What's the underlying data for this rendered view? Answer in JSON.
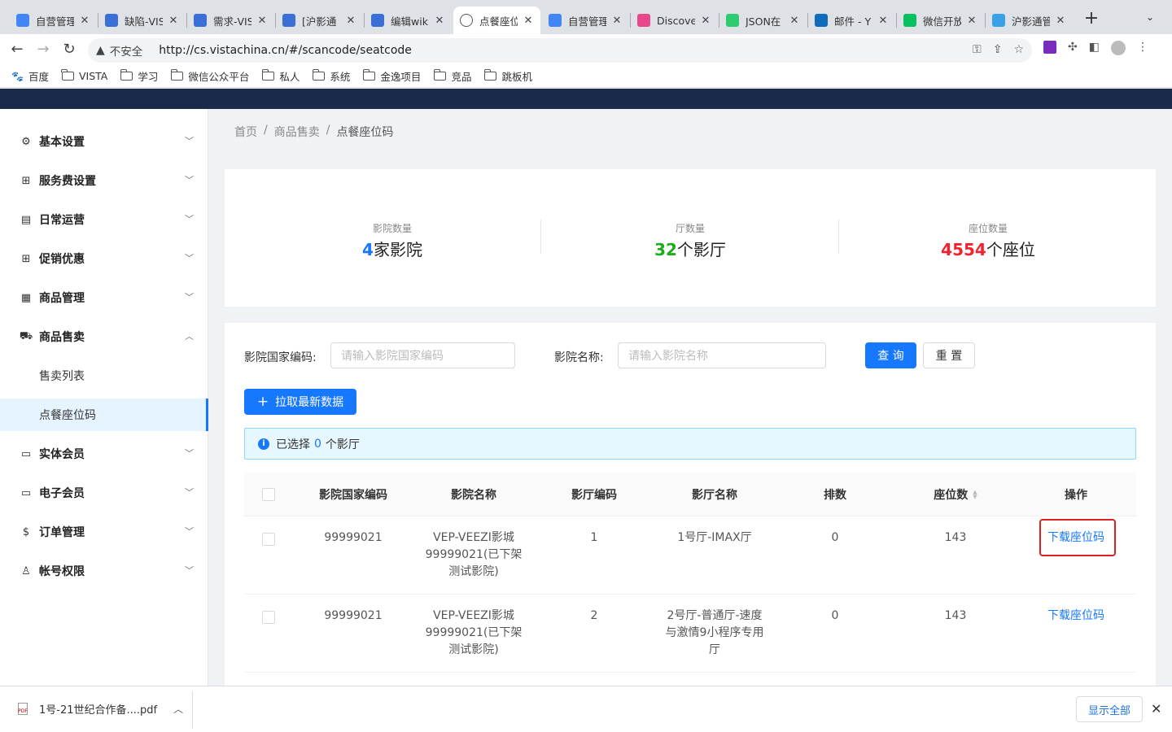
{
  "browser": {
    "tabs": [
      {
        "title": "自营管理",
        "favicon": "grid-colorful-icon",
        "color": "#4285f4"
      },
      {
        "title": "缺陷-VIS",
        "favicon": "vista-icon",
        "color": "#3a6fd8"
      },
      {
        "title": "需求-VIS",
        "favicon": "vista-icon",
        "color": "#3a6fd8"
      },
      {
        "title": "[沪影通",
        "favicon": "vista-icon",
        "color": "#3a6fd8"
      },
      {
        "title": "编辑wik",
        "favicon": "vista-icon",
        "color": "#3a6fd8"
      },
      {
        "title": "点餐座位",
        "favicon": "globe-icon",
        "color": "#555555",
        "active": true
      },
      {
        "title": "自营管理",
        "favicon": "grid-colorful-icon",
        "color": "#4285f4"
      },
      {
        "title": "Discove",
        "favicon": "kibana-icon",
        "color": "#e8478b"
      },
      {
        "title": "JSON在",
        "favicon": "json-icon",
        "color": "#2ecc71"
      },
      {
        "title": "邮件 - Y",
        "favicon": "outlook-icon",
        "color": "#0f6cbd"
      },
      {
        "title": "微信开放",
        "favicon": "wechat-icon",
        "color": "#07c160"
      },
      {
        "title": "沪影通管",
        "favicon": "hy-icon",
        "color": "#3aa0e8"
      }
    ],
    "security_label": "不安全",
    "url": "http://cs.vistachina.cn/#/scancode/seatcode",
    "bookmarks": [
      "百度",
      "VISTA",
      "学习",
      "微信公众平台",
      "私人",
      "系统",
      "金逸项目",
      "竞品",
      "跳板机"
    ]
  },
  "sidebar": {
    "menus": [
      {
        "label": "基本设置",
        "icon": "gear-icon",
        "glyph": "⚙",
        "expanded": false
      },
      {
        "label": "服务费设置",
        "icon": "gift-icon",
        "glyph": "⊞",
        "expanded": false
      },
      {
        "label": "日常运营",
        "icon": "calendar-icon",
        "glyph": "▤",
        "expanded": false
      },
      {
        "label": "促销优惠",
        "icon": "gift-icon",
        "glyph": "⊞",
        "expanded": false
      },
      {
        "label": "商品管理",
        "icon": "shop-icon",
        "glyph": "▦",
        "expanded": false
      },
      {
        "label": "商品售卖",
        "icon": "cart-icon",
        "glyph": "⛟",
        "expanded": true
      },
      {
        "label": "实体会员",
        "icon": "idcard-icon",
        "glyph": "▭",
        "expanded": false
      },
      {
        "label": "电子会员",
        "icon": "idcard-icon",
        "glyph": "▭",
        "expanded": false
      },
      {
        "label": "订单管理",
        "icon": "dollar-icon",
        "glyph": "$",
        "expanded": false
      },
      {
        "label": "帐号权限",
        "icon": "user-icon",
        "glyph": "♙",
        "expanded": false
      }
    ],
    "submenu": [
      {
        "label": "售卖列表",
        "active": false
      },
      {
        "label": "点餐座位码",
        "active": true
      }
    ]
  },
  "breadcrumb": [
    "首页",
    "商品售卖",
    "点餐座位码"
  ],
  "stats": [
    {
      "label": "影院数量",
      "value": "4",
      "unit": "家影院",
      "color": "#1677ff"
    },
    {
      "label": "厅数量",
      "value": "32",
      "unit": "个影厅",
      "color": "#1aad19"
    },
    {
      "label": "座位数量",
      "value": "4554",
      "unit": "个座位",
      "color": "#f5222d"
    }
  ],
  "filters": {
    "code_label": "影院国家编码:",
    "code_placeholder": "请输入影院国家编码",
    "name_label": "影院名称:",
    "name_placeholder": "请输入影院名称",
    "search_button": "查 询",
    "reset_button": "重 置"
  },
  "fetch_button": "拉取最新数据",
  "selection": {
    "prefix": "已选择",
    "count": "0",
    "suffix": "个影厅"
  },
  "table": {
    "columns": [
      "影院国家编码",
      "影院名称",
      "影厅编码",
      "影厅名称",
      "排数",
      "座位数",
      "操作"
    ],
    "rows": [
      {
        "code": "99999021",
        "cinema": "VEP-VEEZI影城99999021(已下架测试影院)",
        "hall_code": "1",
        "hall_name": "1号厅-IMAX厅",
        "rows": "0",
        "seats": "143",
        "action": "下载座位码"
      },
      {
        "code": "99999021",
        "cinema": "VEP-VEEZI影城99999021(已下架测试影院)",
        "hall_code": "2",
        "hall_name": "2号厅-普通厅-速度与激情9小程序专用厅",
        "rows": "0",
        "seats": "143",
        "action": "下载座位码"
      }
    ]
  },
  "downloads": {
    "file": "1号-21世纪合作备....pdf",
    "show_all": "显示全部"
  }
}
